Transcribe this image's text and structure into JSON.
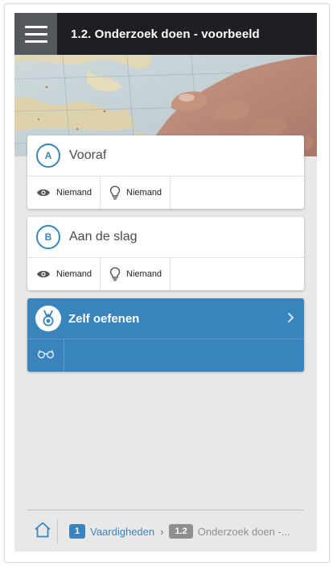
{
  "header": {
    "title": "1.2. Onderzoek doen - voorbeeld"
  },
  "cards": [
    {
      "badge": "A",
      "title": "Vooraf",
      "views_label": "Niemand",
      "hints_label": "Niemand"
    },
    {
      "badge": "B",
      "title": "Aan de slag",
      "views_label": "Niemand",
      "hints_label": "Niemand"
    }
  ],
  "practice": {
    "title": "Zelf oefenen"
  },
  "breadcrumb": {
    "items": [
      {
        "number": "1",
        "label": "Vaardigheden"
      },
      {
        "number": "1.2",
        "label": "Onderzoek doen -..."
      }
    ]
  },
  "colors": {
    "accent": "#3a84bd",
    "header_bg": "#1d1f22",
    "menu_bg": "#54575b",
    "panel_bg": "#e8e8e8",
    "inactive": "#8f8f8f"
  },
  "icons": {
    "menu": "hamburger-icon",
    "views": "eye-icon",
    "hints": "lightbulb-icon",
    "practice": "medal-icon",
    "open": "chevron-right-icon",
    "observe": "glasses-icon",
    "home": "home-icon"
  }
}
